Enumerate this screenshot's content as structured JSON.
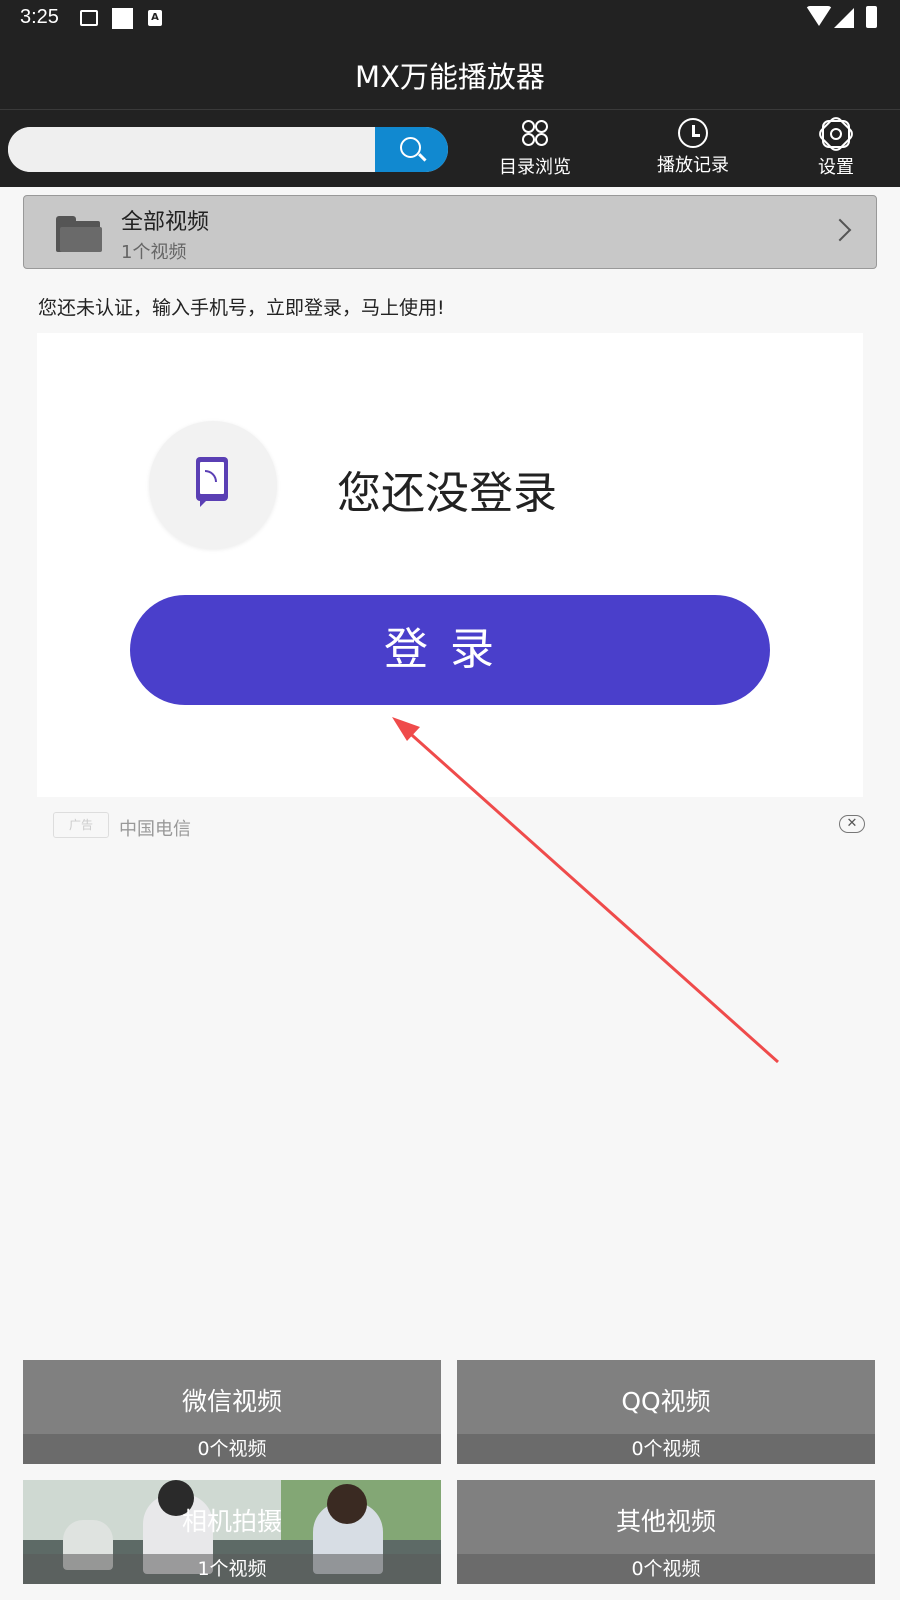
{
  "status_bar": {
    "time": "3:25"
  },
  "app": {
    "title": "MX万能播放器"
  },
  "search": {
    "placeholder": ""
  },
  "nav": [
    {
      "label": "目录浏览",
      "icon": "grid-icon"
    },
    {
      "label": "播放记录",
      "icon": "clock-icon"
    },
    {
      "label": "设置",
      "icon": "gear-icon"
    }
  ],
  "all_videos": {
    "title": "全部视频",
    "count": "1个视频"
  },
  "notice": "您还未认证，输入手机号，立即登录，马上使用!",
  "ad": {
    "heading": "您还没登录",
    "button_label": "登录",
    "tag": "广告",
    "source": "中国电信"
  },
  "tiles": [
    {
      "name": "微信视频",
      "count": "0个视频"
    },
    {
      "name": "QQ视频",
      "count": "0个视频"
    },
    {
      "name": "相机拍摄",
      "count": "1个视频"
    },
    {
      "name": "其他视频",
      "count": "0个视频"
    }
  ],
  "colors": {
    "bar_bg": "#222222",
    "search_button": "#1189d0",
    "login_button": "#4a3fcb",
    "arrow": "#ef4b4b",
    "tile_bg": "#808080"
  }
}
